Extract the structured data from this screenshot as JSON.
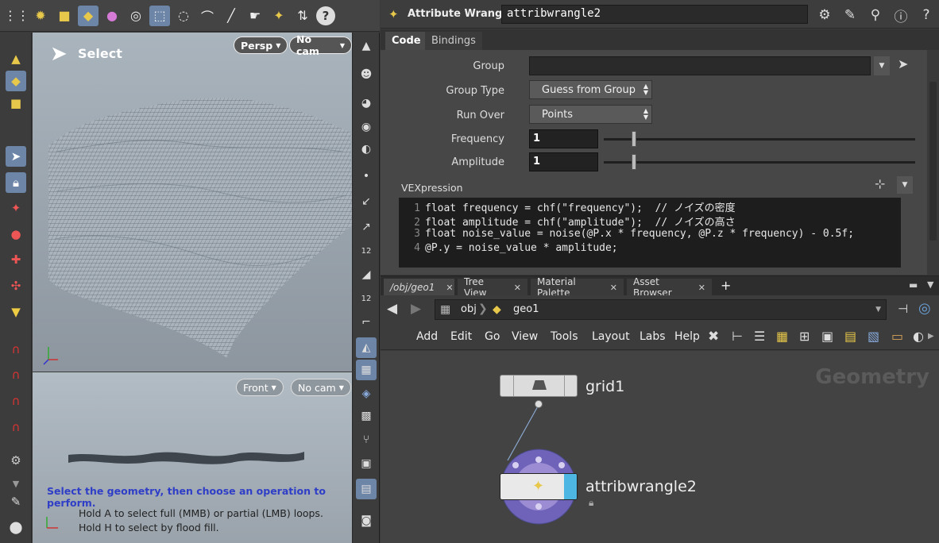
{
  "toolbar": {
    "icons": [
      "grid-menu-icon",
      "sphere-tool-icon",
      "box-tool-icon",
      "select-mode-icon",
      "point-dot-icon",
      "circle-target-icon",
      "box-select-icon",
      "lasso-select-icon",
      "brush-select-icon",
      "laser-select-icon",
      "pointer-pick-icon",
      "pack-select-icon",
      "align-icon",
      "help-icon"
    ],
    "help_label": "?"
  },
  "viewport_persp": {
    "mode_label": "Select",
    "camera_view": "Persp",
    "camera_dropdown": "No cam"
  },
  "viewport_front": {
    "camera_view": "Front",
    "camera_dropdown": "No cam",
    "hint_main": "Select the geometry, then choose an operation to perform.",
    "hint_line1": "Hold A to select full (MMB) or partial (LMB) loops.",
    "hint_line2": "Hold H to select by flood fill."
  },
  "param_pane": {
    "node_type": "Attribute Wrangle",
    "node_name": "attribwrangle2",
    "tabs": [
      {
        "label": "Code",
        "active": true
      },
      {
        "label": "Bindings",
        "active": false
      }
    ],
    "params": {
      "group_label": "Group",
      "group_value": "",
      "group_type_label": "Group Type",
      "group_type_value": "Guess from Group",
      "run_over_label": "Run Over",
      "run_over_value": "Points",
      "frequency_label": "Frequency",
      "frequency_value": "1",
      "amplitude_label": "Amplitude",
      "amplitude_value": "1"
    },
    "vexpression_label": "VEXpression",
    "code_lines": [
      {
        "num": "1",
        "text": "float frequency = chf(\"frequency\");  // ノイズの密度"
      },
      {
        "num": "2",
        "text": "float amplitude = chf(\"amplitude\");  // ノイズの高さ"
      },
      {
        "num": "3",
        "text": "float noise_value = noise(@P.x * frequency, @P.z * frequency) - 0.5f;"
      },
      {
        "num": "4",
        "text": "@P.y = noise_value * amplitude;"
      }
    ]
  },
  "network_tabs": [
    {
      "label": "/obj/geo1",
      "active": true
    },
    {
      "label": "Tree View",
      "active": false
    },
    {
      "label": "Material Palette",
      "active": false
    },
    {
      "label": "Asset Browser",
      "active": false
    }
  ],
  "network_path": {
    "level1": "obj",
    "level2": "geo1"
  },
  "network_menu": [
    "Add",
    "Edit",
    "Go",
    "View",
    "Tools",
    "Layout",
    "Labs",
    "Help"
  ],
  "network": {
    "context_label": "Geometry",
    "nodes": [
      {
        "name": "grid1"
      },
      {
        "name": "attribwrangle2"
      }
    ]
  },
  "colors": {
    "selection_blue": "#6d86a8",
    "hint_blue": "#2f3ec7",
    "wrangle_ring": "#6e63b8"
  }
}
